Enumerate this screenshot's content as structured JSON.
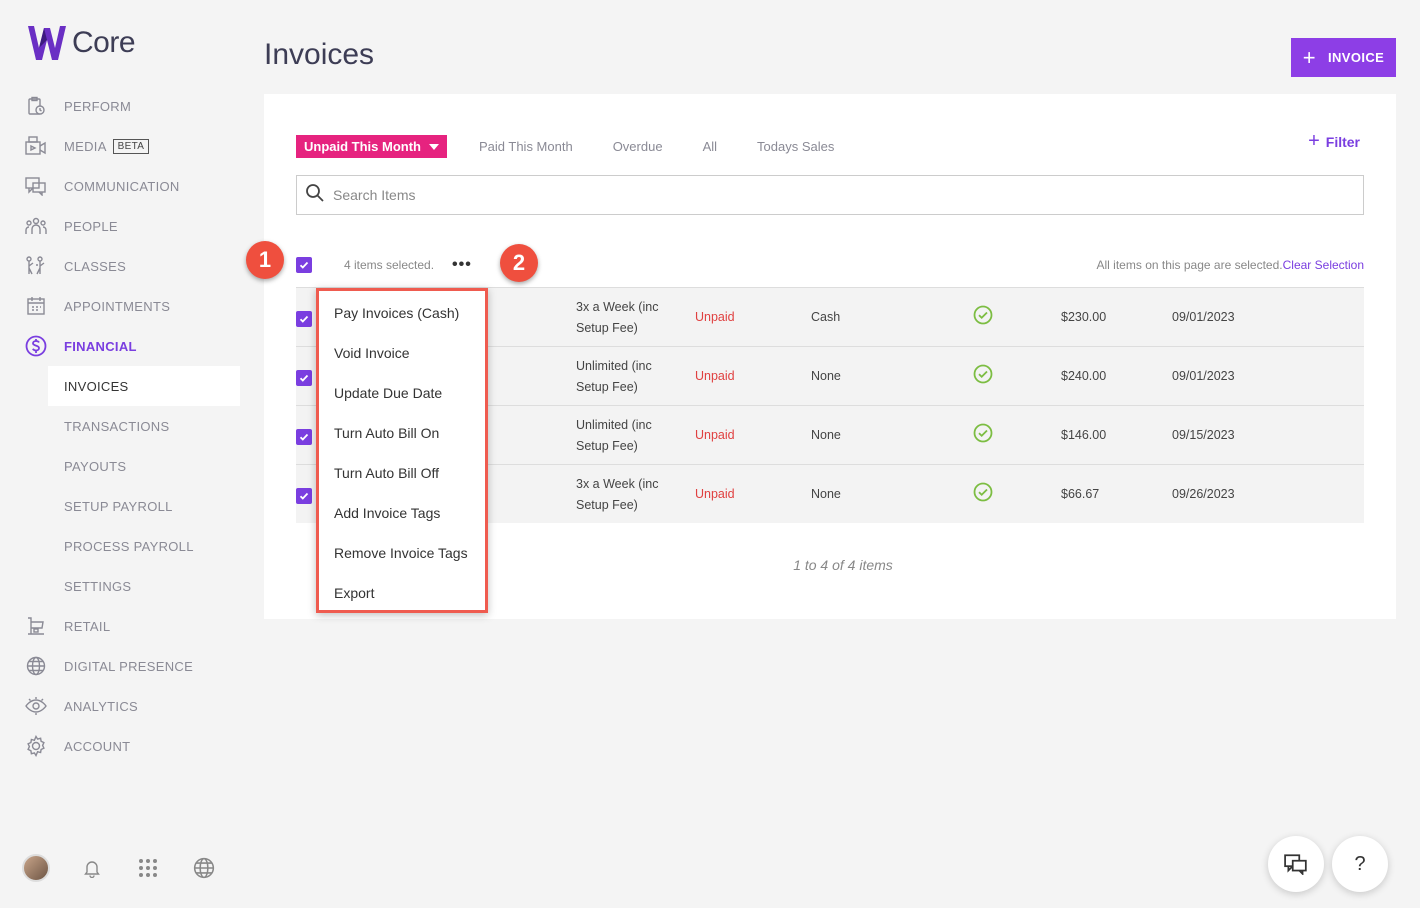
{
  "app": {
    "logo_text": "Core"
  },
  "sidebar": {
    "items": [
      {
        "label": "PERFORM",
        "icon": "clipboard-clock-icon"
      },
      {
        "label": "MEDIA",
        "badge": "BETA",
        "icon": "video-icon"
      },
      {
        "label": "COMMUNICATION",
        "icon": "chat-icon"
      },
      {
        "label": "PEOPLE",
        "icon": "people-icon"
      },
      {
        "label": "CLASSES",
        "icon": "classes-icon"
      },
      {
        "label": "APPOINTMENTS",
        "icon": "calendar-icon"
      },
      {
        "label": "FINANCIAL",
        "icon": "dollar-circle-icon",
        "active": true
      }
    ],
    "financial_sub": [
      {
        "label": "INVOICES",
        "active": true
      },
      {
        "label": "TRANSACTIONS"
      },
      {
        "label": "PAYOUTS"
      },
      {
        "label": "SETUP PAYROLL"
      },
      {
        "label": "PROCESS PAYROLL"
      },
      {
        "label": "SETTINGS"
      }
    ],
    "items_after": [
      {
        "label": "RETAIL",
        "icon": "store-icon"
      },
      {
        "label": "DIGITAL PRESENCE",
        "icon": "globe-icon"
      },
      {
        "label": "ANALYTICS",
        "icon": "eye-icon"
      },
      {
        "label": "ACCOUNT",
        "icon": "gear-icon"
      }
    ]
  },
  "header": {
    "title": "Invoices",
    "new_button": "INVOICE"
  },
  "tabs": [
    {
      "label": "Unpaid This Month",
      "active": true
    },
    {
      "label": "Paid This Month"
    },
    {
      "label": "Overdue"
    },
    {
      "label": "All"
    },
    {
      "label": "Todays Sales"
    }
  ],
  "filter_label": "Filter",
  "search": {
    "placeholder": "Search Items"
  },
  "selection": {
    "count_text": "4 items selected.",
    "all_selected_text": "All items on this page are selected.",
    "clear_label": "Clear Selection"
  },
  "rows": [
    {
      "plan_line1": "3x a Week (inc",
      "plan_line2": "Setup Fee)",
      "status": "Unpaid",
      "payment": "Cash",
      "amount": "$230.00",
      "date": "09/01/2023"
    },
    {
      "plan_line1": "Unlimited (inc",
      "plan_line2": "Setup Fee)",
      "status": "Unpaid",
      "payment": "None",
      "amount": "$240.00",
      "date": "09/01/2023"
    },
    {
      "plan_line1": "Unlimited (inc",
      "plan_line2": "Setup Fee)",
      "status": "Unpaid",
      "payment": "None",
      "amount": "$146.00",
      "date": "09/15/2023"
    },
    {
      "plan_line1": "3x a Week (inc",
      "plan_line2": "Setup Fee)",
      "status": "Unpaid",
      "payment": "None",
      "amount": "$66.67",
      "date": "09/26/2023"
    }
  ],
  "pager_text": "1 to 4 of 4 items",
  "bulk_menu": [
    "Pay Invoices (Cash)",
    "Void Invoice",
    "Update Due Date",
    "Turn Auto Bill On",
    "Turn Auto Bill Off",
    "Add Invoice Tags",
    "Remove Invoice Tags",
    "Export"
  ],
  "callouts": [
    "1",
    "2"
  ],
  "fab_help": "?",
  "colors": {
    "accent": "#7a3ee0",
    "tab_active": "#e6237f",
    "status_unpaid": "#e04040",
    "callout": "#ef4f3e",
    "check": "#7cbd42"
  }
}
